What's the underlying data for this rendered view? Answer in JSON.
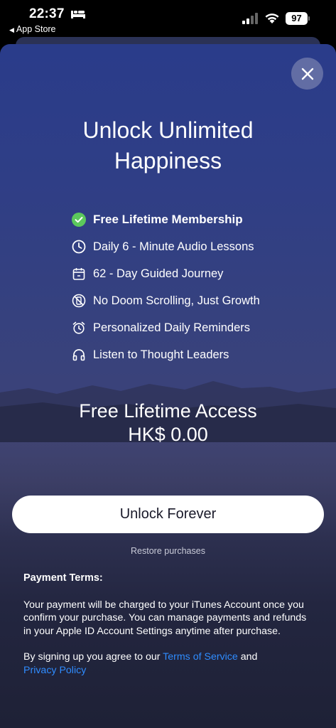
{
  "status_bar": {
    "time": "22:37",
    "back_label": "App Store",
    "battery": "97"
  },
  "title": [
    "Unlock Unlimited",
    "Happiness"
  ],
  "features": [
    {
      "label": "Free Lifetime Membership",
      "icon": "check-circle-icon"
    },
    {
      "label": "Daily 6 - Minute Audio Lessons",
      "icon": "clock-icon"
    },
    {
      "label": "62 - Day Guided Journey",
      "icon": "calendar-icon"
    },
    {
      "label": "No Doom Scrolling, Just Growth",
      "icon": "no-scroll-icon"
    },
    {
      "label": "Personalized Daily Reminders",
      "icon": "alarm-icon"
    },
    {
      "label": "Listen to Thought Leaders",
      "icon": "headphones-icon"
    }
  ],
  "pricing": {
    "headline": "Free Lifetime Access",
    "price": "HK$ 0.00"
  },
  "cta_label": "Unlock Forever",
  "restore_label": "Restore purchases",
  "terms": {
    "heading": "Payment Terms:",
    "body": "Your payment will be charged to your iTunes Account once you confirm your purchase. You can manage payments and refunds in your Apple ID Account Settings anytime after purchase.",
    "signup_prefix": "By signing up you agree to our ",
    "terms_link": "Terms of Service",
    "and": " and",
    "privacy_link": "Privacy Policy"
  },
  "colors": {
    "accent_check": "#5cc95c",
    "link": "#2f8cff",
    "sheet_top": "#2a3c8a",
    "sheet_bottom": "#1e2136"
  }
}
